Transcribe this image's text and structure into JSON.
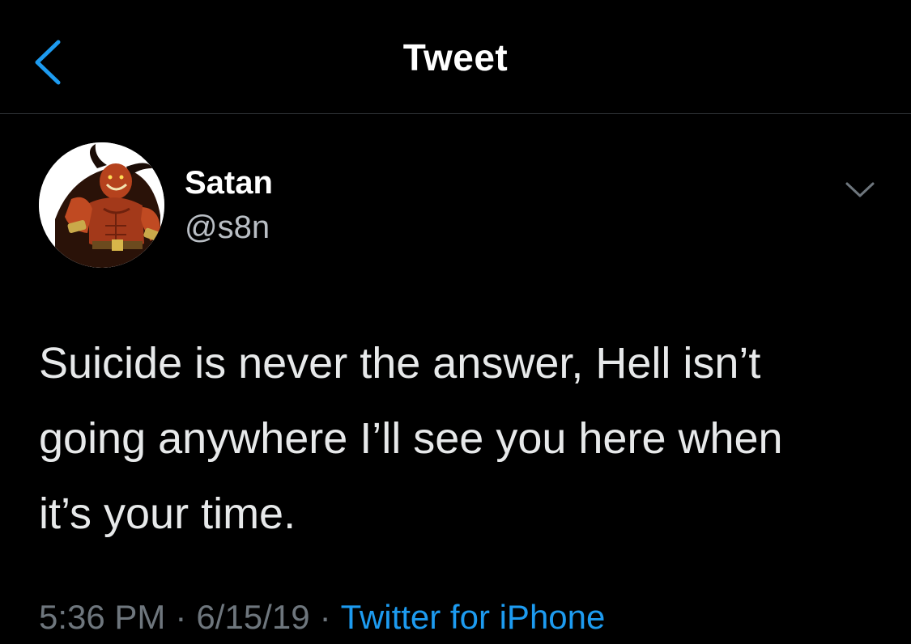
{
  "nav": {
    "title": "Tweet",
    "back_icon": "chevron-left-icon"
  },
  "tweet": {
    "author": {
      "name": "Satan",
      "handle": "@s8n",
      "avatar_icon": "horned-demon-avatar"
    },
    "more_icon": "chevron-down-icon",
    "text": "Suicide is never the answer, Hell isn’t\ngoing anywhere I’ll see you here when\nit’s your time.",
    "time": "5:36 PM",
    "date": "6/15/19",
    "separator": "·",
    "source": "Twitter for iPhone"
  },
  "colors": {
    "background": "#000000",
    "accent": "#1d9bf0",
    "primary_text": "#e7e9ea",
    "secondary_text": "#6e767d",
    "divider": "#2f3336"
  }
}
